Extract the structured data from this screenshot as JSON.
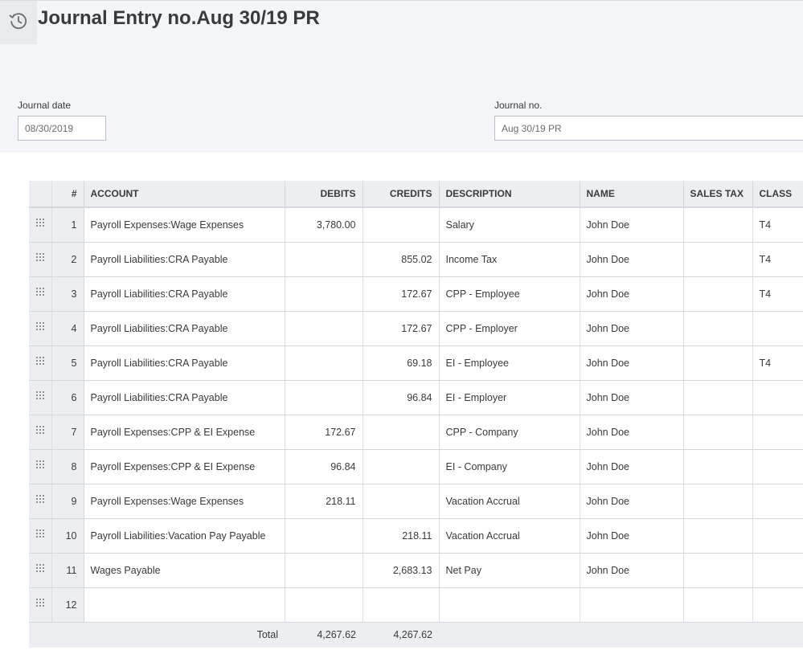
{
  "page": {
    "title": "Journal Entry no.Aug 30/19 PR",
    "history_icon": "history-clock-icon"
  },
  "form": {
    "journal_date_label": "Journal date",
    "journal_date_value": "08/30/2019",
    "journal_no_label": "Journal no.",
    "journal_no_value": "Aug 30/19 PR"
  },
  "table": {
    "columns": {
      "index": "#",
      "account": "ACCOUNT",
      "debits": "DEBITS",
      "credits": "CREDITS",
      "description": "DESCRIPTION",
      "name": "NAME",
      "sales_tax": "SALES TAX",
      "class": "CLASS"
    },
    "drag_icon": "drag-handle-icon",
    "rows": [
      {
        "index": "1",
        "account": "Payroll Expenses:Wage Expenses",
        "debits": "3,780.00",
        "credits": "",
        "description": "Salary",
        "name": "John Doe",
        "sales_tax": "",
        "class": "T4"
      },
      {
        "index": "2",
        "account": "Payroll Liabilities:CRA Payable",
        "debits": "",
        "credits": "855.02",
        "description": "Income Tax",
        "name": "John Doe",
        "sales_tax": "",
        "class": "T4"
      },
      {
        "index": "3",
        "account": "Payroll Liabilities:CRA Payable",
        "debits": "",
        "credits": "172.67",
        "description": "CPP - Employee",
        "name": "John Doe",
        "sales_tax": "",
        "class": "T4"
      },
      {
        "index": "4",
        "account": "Payroll Liabilities:CRA Payable",
        "debits": "",
        "credits": "172.67",
        "description": "CPP - Employer",
        "name": "John Doe",
        "sales_tax": "",
        "class": ""
      },
      {
        "index": "5",
        "account": "Payroll Liabilities:CRA Payable",
        "debits": "",
        "credits": "69.18",
        "description": "EI - Employee",
        "name": "John Doe",
        "sales_tax": "",
        "class": "T4"
      },
      {
        "index": "6",
        "account": "Payroll Liabilities:CRA Payable",
        "debits": "",
        "credits": "96.84",
        "description": "EI - Employer",
        "name": "John Doe",
        "sales_tax": "",
        "class": ""
      },
      {
        "index": "7",
        "account": "Payroll Expenses:CPP & EI Expense",
        "debits": "172.67",
        "credits": "",
        "description": "CPP - Company",
        "name": "John Doe",
        "sales_tax": "",
        "class": ""
      },
      {
        "index": "8",
        "account": "Payroll Expenses:CPP & EI Expense",
        "debits": "96.84",
        "credits": "",
        "description": "EI - Company",
        "name": "John Doe",
        "sales_tax": "",
        "class": ""
      },
      {
        "index": "9",
        "account": "Payroll Expenses:Wage Expenses",
        "debits": "218.11",
        "credits": "",
        "description": "Vacation Accrual",
        "name": "John Doe",
        "sales_tax": "",
        "class": ""
      },
      {
        "index": "10",
        "account": "Payroll Liabilities:Vacation Pay Payable",
        "debits": "",
        "credits": "218.11",
        "description": "Vacation Accrual",
        "name": "John Doe",
        "sales_tax": "",
        "class": ""
      },
      {
        "index": "11",
        "account": "Wages Payable",
        "debits": "",
        "credits": "2,683.13",
        "description": "Net Pay",
        "name": "John Doe",
        "sales_tax": "",
        "class": ""
      },
      {
        "index": "12",
        "account": "",
        "debits": "",
        "credits": "",
        "description": "",
        "name": "",
        "sales_tax": "",
        "class": ""
      }
    ],
    "total": {
      "label": "Total",
      "debits": "4,267.62",
      "credits": "4,267.62"
    }
  }
}
